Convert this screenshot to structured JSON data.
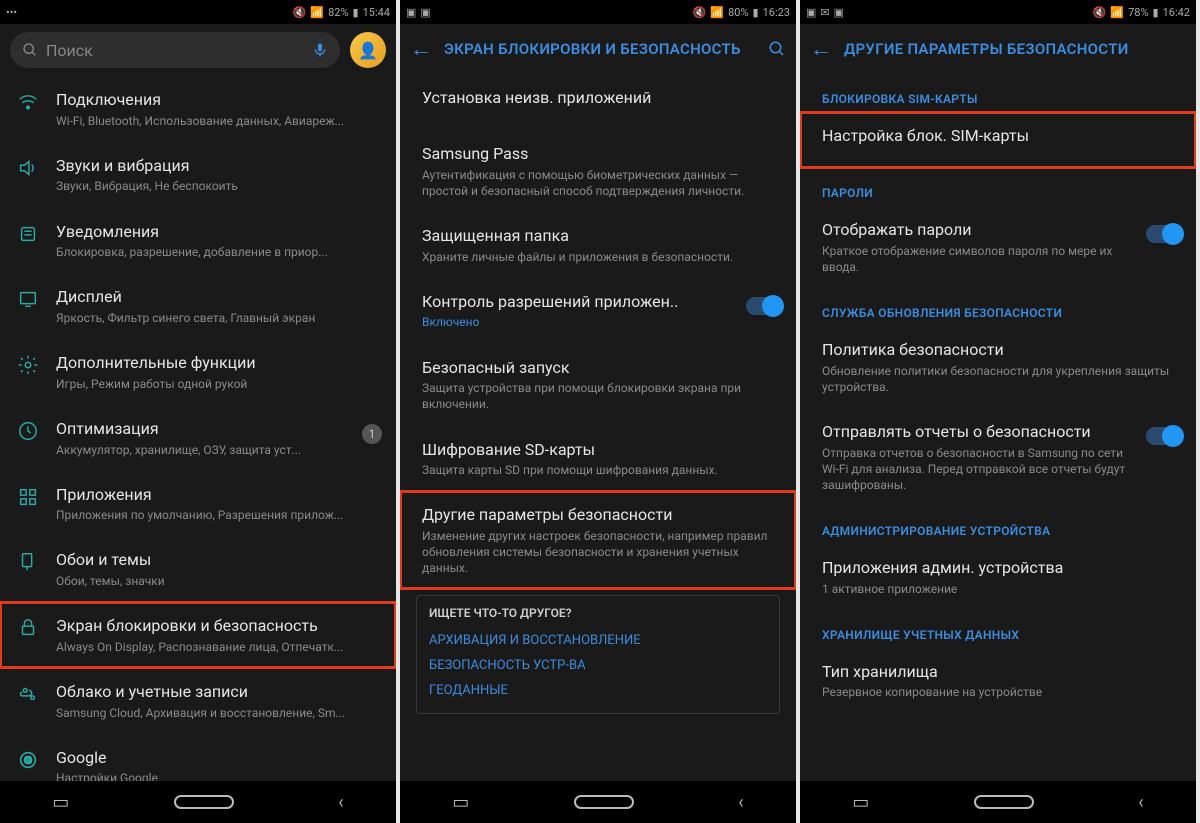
{
  "screen1": {
    "status": {
      "left": "•••",
      "battery": "82%",
      "time": "15:44"
    },
    "search_placeholder": "Поиск",
    "items": [
      {
        "icon": "connections",
        "title": "Подключения",
        "sub": "Wi-Fi, Bluetooth, Использование данных, Авиареж..."
      },
      {
        "icon": "sound",
        "title": "Звуки и вибрация",
        "sub": "Звуки, Вибрация, Не беспокоить"
      },
      {
        "icon": "notifications",
        "title": "Уведомления",
        "sub": "Блокировка, разрешение, добавление в приор..."
      },
      {
        "icon": "display",
        "title": "Дисплей",
        "sub": "Яркость, Фильтр синего света, Главный экран"
      },
      {
        "icon": "advanced",
        "title": "Дополнительные функции",
        "sub": "Игры, Режим работы одной рукой"
      },
      {
        "icon": "maintenance",
        "title": "Оптимизация",
        "sub": "Аккумулятор, хранилище, ОЗУ, защита уст...",
        "badge": "1"
      },
      {
        "icon": "apps",
        "title": "Приложения",
        "sub": "Приложения по умолчанию, Разрешения прилож..."
      },
      {
        "icon": "wallpaper",
        "title": "Обои и темы",
        "sub": "Обои, темы, значки"
      },
      {
        "icon": "lock",
        "title": "Экран блокировки и безопасность",
        "sub": "Always On Display, Распознавание лица, Отпечатк...",
        "highlight": true
      },
      {
        "icon": "cloud",
        "title": "Облако и учетные записи",
        "sub": "Samsung Cloud, Архивация и восстановление, Sm..."
      },
      {
        "icon": "google",
        "title": "Google",
        "sub": "Настройки Google"
      }
    ]
  },
  "screen2": {
    "status": {
      "battery": "80%",
      "time": "16:23"
    },
    "title": "ЭКРАН БЛОКИРОВКИ И БЕЗОПАСНОСТЬ",
    "items": [
      {
        "title": "Установка неизв. приложений"
      },
      {
        "title": "Samsung Pass",
        "sub": "Аутентификация с помощью биометрических данных — простой и безопасный способ подтверждения личности."
      },
      {
        "title": "Защищенная папка",
        "sub": "Храните личные файлы и приложения в безопасности."
      },
      {
        "title": "Контроль разрешений приложен..",
        "sub": "Включено",
        "subBlue": true,
        "toggle": true
      },
      {
        "title": "Безопасный запуск",
        "sub": "Защита устройства при помощи блокировки экрана при включении."
      },
      {
        "title": "Шифрование SD-карты",
        "sub": "Защита карты SD при помощи шифрования данных."
      },
      {
        "title": "Другие параметры безопасности",
        "sub": "Изменение других настроек безопасности, например правил обновления системы безопасности и хранения учетных данных.",
        "highlight": true
      }
    ],
    "other_title": "ИЩЕТЕ ЧТО-ТО ДРУГОЕ?",
    "other_links": [
      "АРХИВАЦИЯ И ВОССТАНОВЛЕНИЕ",
      "БЕЗОПАСНОСТЬ УСТР-ВА",
      "ГЕОДАННЫЕ"
    ]
  },
  "screen3": {
    "status": {
      "battery": "78%",
      "time": "16:42"
    },
    "title": "ДРУГИЕ ПАРАМЕТРЫ БЕЗОПАСНОСТИ",
    "sections": [
      {
        "header": "БЛОКИРОВКА SIM-КАРТЫ",
        "items": [
          {
            "title": "Настройка блок. SIM-карты",
            "highlight": true
          }
        ]
      },
      {
        "header": "ПАРОЛИ",
        "items": [
          {
            "title": "Отображать пароли",
            "sub": "Краткое отображение символов пароля по мере их ввода.",
            "toggle": true
          }
        ]
      },
      {
        "header": "СЛУЖБА ОБНОВЛЕНИЯ БЕЗОПАСНОСТИ",
        "items": [
          {
            "title": "Политика безопасности",
            "sub": "Обновление политики безопасности для укрепления защиты устройства."
          },
          {
            "title": "Отправлять отчеты о безопасности",
            "sub": "Отправка отчетов о безопасности в Samsung по сети Wi-Fi для анализа. Перед отправкой все отчеты будут зашифрованы.",
            "toggle": true
          }
        ]
      },
      {
        "header": "АДМИНИСТРИРОВАНИЕ УСТРОЙСТВА",
        "items": [
          {
            "title": "Приложения админ. устройства",
            "sub": "1 активное приложение"
          }
        ]
      },
      {
        "header": "ХРАНИЛИЩЕ УЧЕТНЫХ ДАННЫХ",
        "items": [
          {
            "title": "Тип хранилища",
            "sub": "Резервное копирование на устройстве"
          }
        ]
      }
    ]
  }
}
